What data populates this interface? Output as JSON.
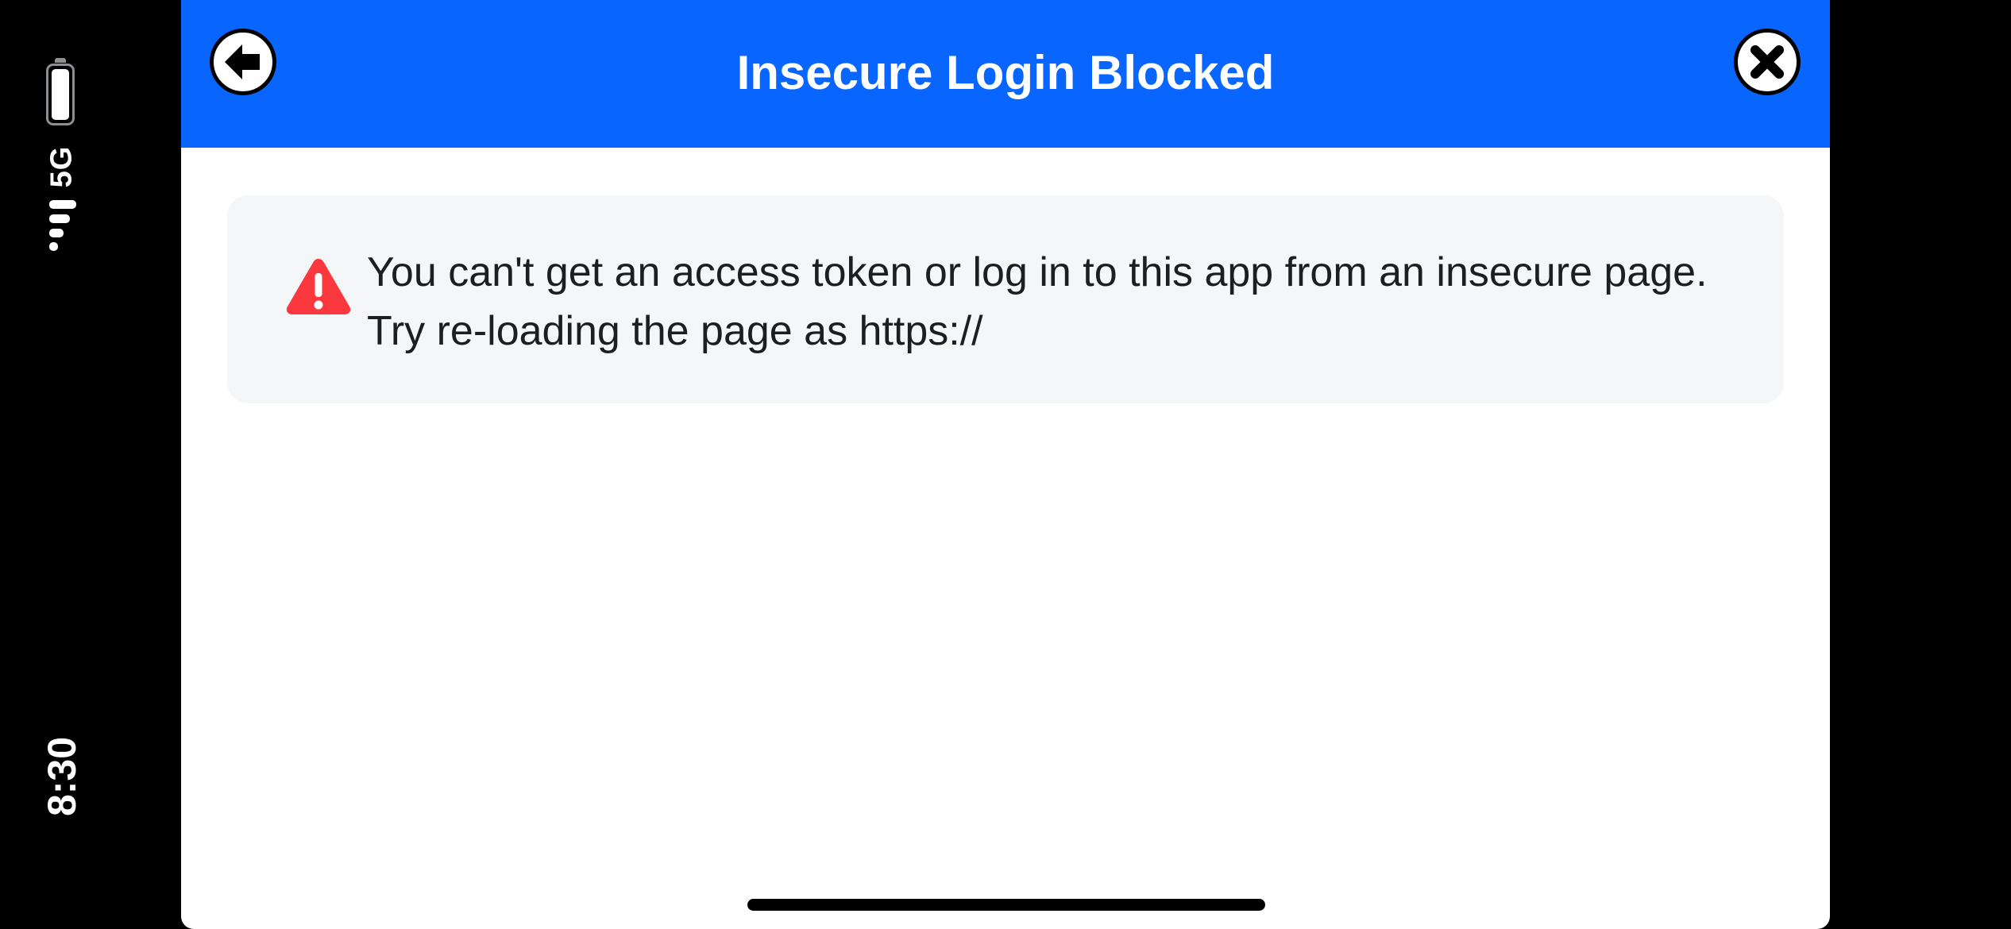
{
  "status_bar": {
    "time": "8:30",
    "network": "5G"
  },
  "dialog": {
    "title": "Insecure Login Blocked",
    "message": "You can't get an access token or log in to this app from an insecure page. Try re-loading the page as https://"
  },
  "colors": {
    "header": "#0866ff",
    "warning": "#fa383e",
    "message_background": "#f5f6f7"
  },
  "icons": {
    "back": "back-arrow-icon",
    "close": "close-icon",
    "warning": "warning-icon"
  }
}
